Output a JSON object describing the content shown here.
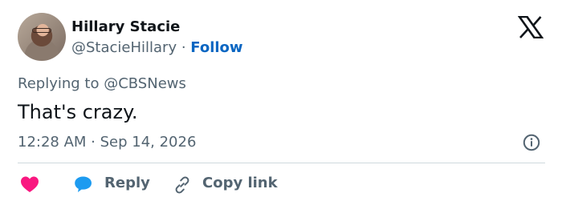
{
  "author": {
    "name": "Hillary Stacie",
    "handle": "@StacieHillary",
    "separator": " · ",
    "follow_label": "Follow"
  },
  "reply_context": {
    "prefix": "Replying to ",
    "target": "@CBSNews"
  },
  "tweet": {
    "text": "That's crazy.",
    "timestamp": "12:28 AM · Sep 14, 2026"
  },
  "actions": {
    "reply_label": "Reply",
    "copy_link_label": "Copy link"
  },
  "colors": {
    "follow": "#0a66c2",
    "heart": "#f91880",
    "reply_bubble": "#1d9bf0",
    "muted_text": "#536471"
  },
  "icons": {
    "close": "x-logo-icon",
    "info": "info-icon",
    "like": "heart-icon",
    "reply": "speech-bubble-icon",
    "copy": "link-icon"
  }
}
